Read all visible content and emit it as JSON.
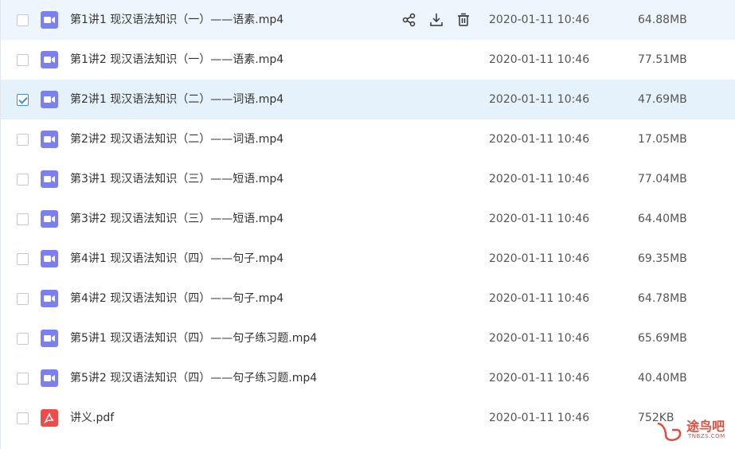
{
  "files": [
    {
      "name": "第1讲1  现汉语法知识（一）——语素.mp4",
      "date": "2020-01-11 10:46",
      "size": "64.88MB",
      "type": "video",
      "checked": false,
      "hover": true
    },
    {
      "name": "第1讲2  现汉语法知识（一）——语素.mp4",
      "date": "2020-01-11 10:46",
      "size": "77.51MB",
      "type": "video",
      "checked": false
    },
    {
      "name": "第2讲1  现汉语法知识（二）——词语.mp4",
      "date": "2020-01-11 10:46",
      "size": "47.69MB",
      "type": "video",
      "checked": true
    },
    {
      "name": "第2讲2  现汉语法知识（二）——词语.mp4",
      "date": "2020-01-11 10:46",
      "size": "17.05MB",
      "type": "video",
      "checked": false
    },
    {
      "name": "第3讲1  现汉语法知识（三）——短语.mp4",
      "date": "2020-01-11 10:46",
      "size": "77.04MB",
      "type": "video",
      "checked": false
    },
    {
      "name": "第3讲2  现汉语法知识（三）——短语.mp4",
      "date": "2020-01-11 10:46",
      "size": "64.40MB",
      "type": "video",
      "checked": false
    },
    {
      "name": "第4讲1  现汉语法知识（四）——句子.mp4",
      "date": "2020-01-11 10:46",
      "size": "69.35MB",
      "type": "video",
      "checked": false
    },
    {
      "name": "第4讲2  现汉语法知识（四）——句子.mp4",
      "date": "2020-01-11 10:46",
      "size": "64.78MB",
      "type": "video",
      "checked": false
    },
    {
      "name": "第5讲1  现汉语法知识（四）——句子练习题.mp4",
      "date": "2020-01-11 10:46",
      "size": "65.69MB",
      "type": "video",
      "checked": false
    },
    {
      "name": "第5讲2  现汉语法知识（四）——句子练习题.mp4",
      "date": "2020-01-11 10:46",
      "size": "40.40MB",
      "type": "video",
      "checked": false
    },
    {
      "name": "讲义.pdf",
      "date": "2020-01-11 10:46",
      "size": "752KB",
      "type": "pdf",
      "checked": false
    }
  ],
  "row_actions": [
    "share-icon",
    "download-icon",
    "delete-icon"
  ],
  "watermark": {
    "text": "途鸟吧",
    "sub": "TNBZS.COM"
  },
  "colors": {
    "video_icon": "#7b7ff0",
    "pdf_icon": "#ee4b4b",
    "hover_row": "#eef6fd",
    "selected_row": "#e5f2fc",
    "checkbox_accent": "#3d8ce6"
  }
}
